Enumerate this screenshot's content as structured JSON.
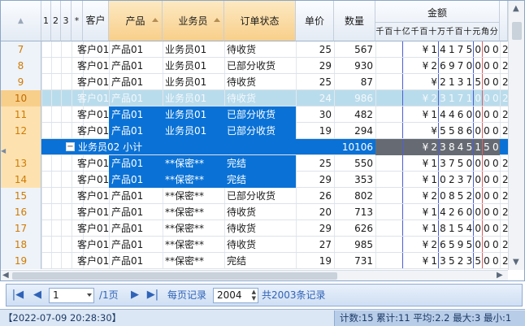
{
  "header": {
    "level_labels": [
      "1",
      "2",
      "3",
      "*"
    ],
    "columns": {
      "customer": "客户",
      "product": "产品",
      "salesman": "业务员",
      "status": "订单状态",
      "price": "单价",
      "qty": "数量",
      "amount": "金额"
    },
    "amount_units": [
      "千",
      "百",
      "十",
      "亿",
      "千",
      "百",
      "十",
      "万",
      "千",
      "百",
      "十",
      "元",
      "角",
      "分"
    ]
  },
  "rows": [
    {
      "rn": "7",
      "customer": "客户01",
      "product": "产品01",
      "salesman": "业务员01",
      "status": "待收货",
      "price": "25",
      "qty": "567",
      "amount": "¥14175000",
      "extra": "2"
    },
    {
      "rn": "8",
      "customer": "客户01",
      "product": "产品01",
      "salesman": "业务员01",
      "status": "已部分收货",
      "price": "29",
      "qty": "930",
      "amount": "¥26970000",
      "extra": "2"
    },
    {
      "rn": "9",
      "customer": "客户01",
      "product": "产品01",
      "salesman": "业务员01",
      "status": "待收货",
      "price": "25",
      "qty": "87",
      "amount": "¥2131500",
      "extra": "2"
    },
    {
      "rn": "10",
      "customer": "客户01",
      "product": "产品01",
      "salesman": "业务员01",
      "status": "待收货",
      "price": "24",
      "qty": "986",
      "amount": "¥23171000",
      "extra": "2"
    },
    {
      "rn": "11",
      "customer": "客户01",
      "product": "产品01",
      "salesman": "业务员01",
      "status": "已部分收货",
      "price": "30",
      "qty": "482",
      "amount": "¥14460000",
      "extra": "2"
    },
    {
      "rn": "12",
      "customer": "客户01",
      "product": "产品01",
      "salesman": "业务员01",
      "status": "已部分收货",
      "price": "19",
      "qty": "294",
      "amount": "¥5586000",
      "extra": "2"
    },
    {
      "rn": "",
      "subtotal_label": "业务员02 小计",
      "qty": "10106",
      "amount": "¥23845150"
    },
    {
      "rn": "13",
      "customer": "客户01",
      "product": "产品01",
      "salesman": "**保密**",
      "status": "完结",
      "price": "25",
      "qty": "550",
      "amount": "¥13750000",
      "extra": "2"
    },
    {
      "rn": "14",
      "customer": "客户01",
      "product": "产品01",
      "salesman": "**保密**",
      "status": "完结",
      "price": "29",
      "qty": "353",
      "amount": "¥10237000",
      "extra": "2"
    },
    {
      "rn": "15",
      "customer": "客户01",
      "product": "产品01",
      "salesman": "**保密**",
      "status": "已部分收货",
      "price": "26",
      "qty": "802",
      "amount": "¥20852000",
      "extra": "2"
    },
    {
      "rn": "16",
      "customer": "客户01",
      "product": "产品01",
      "salesman": "**保密**",
      "status": "待收货",
      "price": "20",
      "qty": "713",
      "amount": "¥14260000",
      "extra": "2"
    },
    {
      "rn": "17",
      "customer": "客户01",
      "product": "产品01",
      "salesman": "**保密**",
      "status": "待收货",
      "price": "29",
      "qty": "626",
      "amount": "¥18154000",
      "extra": "2"
    },
    {
      "rn": "18",
      "customer": "客户01",
      "product": "产品01",
      "salesman": "**保密**",
      "status": "待收货",
      "price": "27",
      "qty": "985",
      "amount": "¥26595000",
      "extra": "2"
    },
    {
      "rn": "19",
      "customer": "客户01",
      "product": "产品01",
      "salesman": "**保密**",
      "status": "完结",
      "price": "19",
      "qty": "731",
      "amount": "¥13523500",
      "extra": "2"
    }
  ],
  "pager": {
    "page_value": "1",
    "page_total": "/1页",
    "per_page_label": "每页记录",
    "per_page_value": "2004",
    "total_label": "共2003条记录"
  },
  "status": {
    "datetime": "【2022-07-09 20:28:30】",
    "stats": "计数:15 累计:11 平均:2.2 最大:3 最小:1"
  },
  "colors": {
    "selection": "#0a72d6",
    "current_row": "#b9dcec",
    "header_selected": "#f8cf8a",
    "row_number": "#d07a00"
  }
}
